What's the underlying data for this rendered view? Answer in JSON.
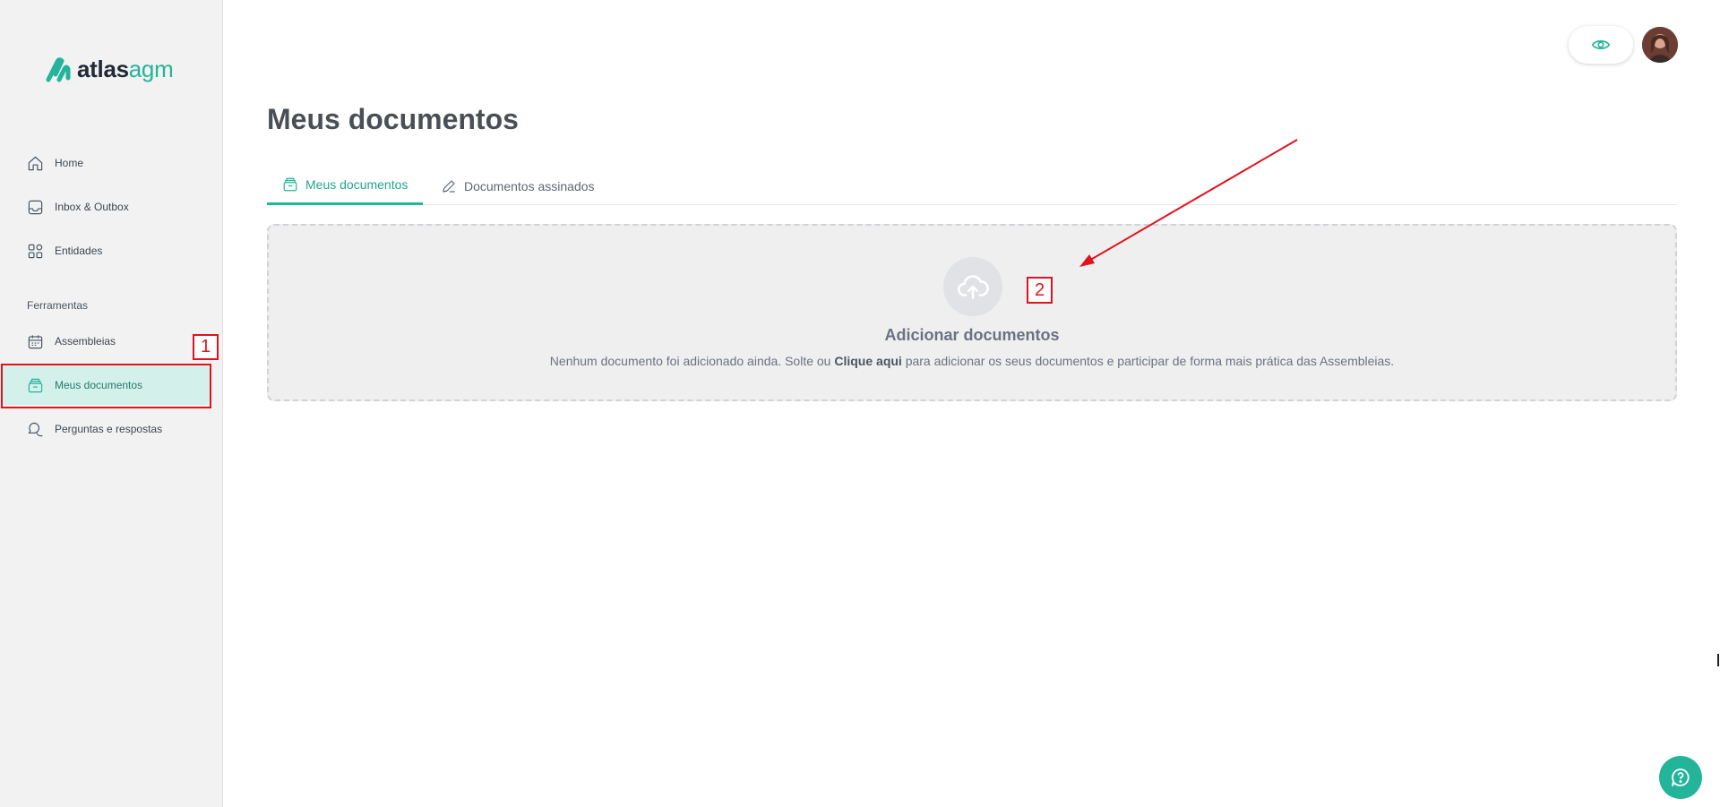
{
  "logo": {
    "part1": "atlas",
    "part2": "agm"
  },
  "sidebar": {
    "items": [
      {
        "label": "Home"
      },
      {
        "label": "Inbox & Outbox"
      },
      {
        "label": "Entidades"
      }
    ],
    "section_label": "Ferramentas",
    "tool_items": [
      {
        "label": "Assembleias"
      },
      {
        "label": "Meus documentos"
      },
      {
        "label": "Perguntas e respostas"
      }
    ]
  },
  "page": {
    "title": "Meus documentos"
  },
  "tabs": [
    {
      "label": "Meus documentos"
    },
    {
      "label": "Documentos assinados"
    }
  ],
  "dropzone": {
    "title": "Adicionar documentos",
    "desc_before": "Nenhum documento foi adicionado ainda. Solte ou ",
    "desc_link": "Clique aqui",
    "desc_after": " para adicionar os seus documentos e participar de forma mais prática das Assembleias."
  },
  "annotations": {
    "label_1": "1",
    "label_2": "2"
  },
  "colors": {
    "accent": "#23b49a",
    "active_bg": "#d3f1ea",
    "annotation": "#e0141e"
  },
  "icons": [
    "home-icon",
    "inbox-icon",
    "entities-icon",
    "calendar-icon",
    "documents-icon",
    "chat-icon",
    "eye-icon",
    "upload-cloud-icon",
    "pen-icon",
    "help-chat-icon"
  ]
}
